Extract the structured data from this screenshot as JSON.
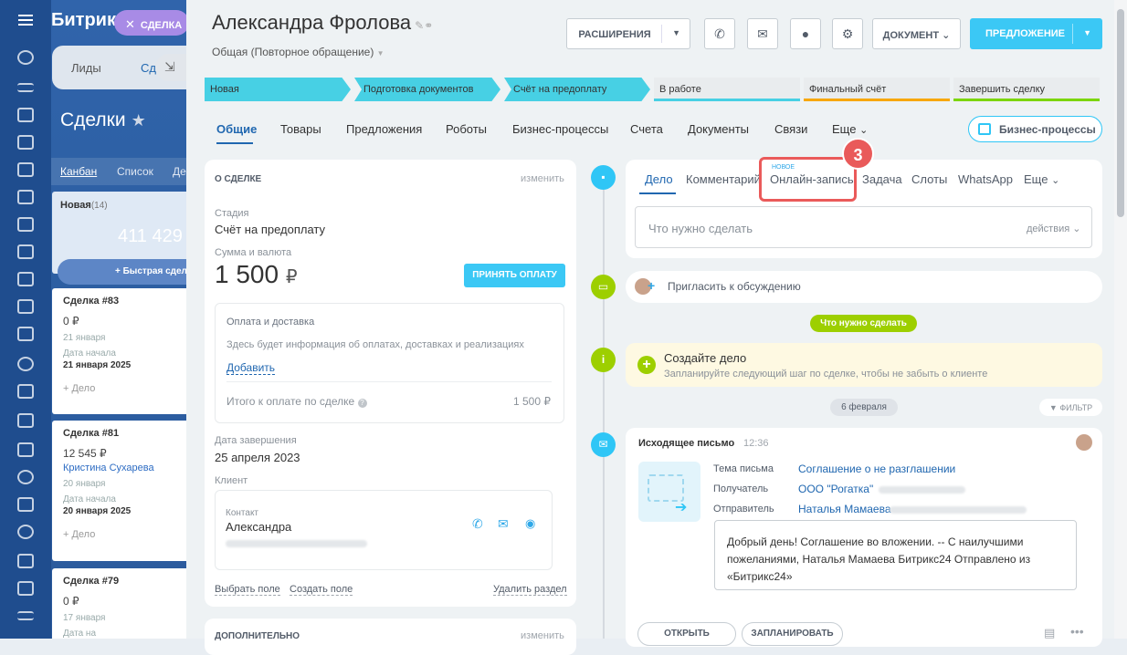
{
  "bg": {
    "brand": "Битрикс",
    "tabs": [
      "Лиды",
      "Сд"
    ],
    "title": "Сделки",
    "views": [
      "Канбан",
      "Список",
      "Де"
    ],
    "column": {
      "name": "Новая",
      "count": "(14)",
      "sum": "411 429",
      "quick": "+ Быстрая сдел"
    },
    "cards": [
      {
        "title": "Сделка #83",
        "amount": "0 ₽",
        "date": "21 января",
        "start_label": "Дата начала",
        "start": "21 января 2025",
        "add": "+ Дело"
      },
      {
        "title": "Сделка #81",
        "amount": "12 545 ₽",
        "contact": "Кристина Сухарева",
        "date": "20 января",
        "start_label": "Дата начала",
        "start": "20 января 2025",
        "add": "+ Дело"
      },
      {
        "title": "Сделка #79",
        "amount": "0 ₽",
        "date": "17 января",
        "start_label": "Дата на"
      }
    ]
  },
  "chip": {
    "label": "СДЕЛКА"
  },
  "deal": {
    "title": "Александра Фролова",
    "category": "Общая (Повторное обращение)"
  },
  "header": {
    "extensions": "РАСШИРЕНИЯ",
    "document": "ДОКУМЕНТ",
    "offer": "ПРЕДЛОЖЕНИЕ"
  },
  "stages": [
    {
      "label": "Новая",
      "active": true
    },
    {
      "label": "Подготовка документов",
      "active": true
    },
    {
      "label": "Счёт на предоплату",
      "active": true
    },
    {
      "label": "В работе",
      "active": false,
      "color": "#47d0e4"
    },
    {
      "label": "Финальный счёт",
      "active": false,
      "color": "#f7a700"
    },
    {
      "label": "Завершить сделку",
      "active": false,
      "color": "#7bd500"
    }
  ],
  "tabs": [
    "Общие",
    "Товары",
    "Предложения",
    "Роботы",
    "Бизнес-процессы",
    "Счета",
    "Документы",
    "Связи",
    "Еще"
  ],
  "bp_button": "Бизнес-процессы",
  "about": {
    "header": "О СДЕЛКЕ",
    "edit": "изменить",
    "stage_label": "Стадия",
    "stage": "Счёт на предоплату",
    "sum_label": "Сумма и валюта",
    "sum": "1 500",
    "currency": "₽",
    "accept": "ПРИНЯТЬ ОПЛАТУ",
    "pay_title": "Оплата и доставка",
    "pay_info": "Здесь будет информация об оплатах, доставках и реализациях",
    "pay_add": "Добавить",
    "total_label": "Итого к оплате по сделке",
    "total": "1 500 ₽",
    "close_label": "Дата завершения",
    "close_date": "25 апреля 2023",
    "client_label": "Клиент",
    "contact_label": "Контакт",
    "contact_name": "Александра",
    "select_field": "Выбрать поле",
    "create_field": "Создать поле",
    "delete_section": "Удалить раздел"
  },
  "extra": {
    "header": "ДОПОЛНИТЕЛЬНО",
    "edit": "изменить"
  },
  "editor": {
    "tabs": [
      "Дело",
      "Комментарий",
      "Онлайн-запись",
      "Задача",
      "Слоты",
      "WhatsApp",
      "Еще"
    ],
    "new_badge": "НОВОЕ",
    "placeholder": "Что нужно сделать",
    "actions": "действия"
  },
  "step_badge": "3",
  "invite": "Пригласить к обсуждению",
  "todo_pill": "Что нужно сделать",
  "create": {
    "title": "Создайте дело",
    "hint": "Запланируйте следующий шаг по сделке, чтобы не забыть о клиенте"
  },
  "date_pill": "6 февраля",
  "filter": "ФИЛЬТР",
  "email": {
    "title": "Исходящее письмо",
    "time": "12:36",
    "subject_label": "Тема письма",
    "subject": "Соглашение о не разглашении",
    "recipient_label": "Получатель",
    "recipient": "ООО \"Рогатка\"",
    "sender_label": "Отправитель",
    "sender": "Наталья Мамаева",
    "body_1": "Добрый день! Соглашение во вложении.    --  С наилучшими",
    "body_2": "пожеланиями, Наталья Мамаева  Битрикс24     Отправлено из",
    "body_3": "«Битрикс24»",
    "open": "ОТКРЫТЬ",
    "schedule": "ЗАПЛАНИРОВАТЬ"
  }
}
